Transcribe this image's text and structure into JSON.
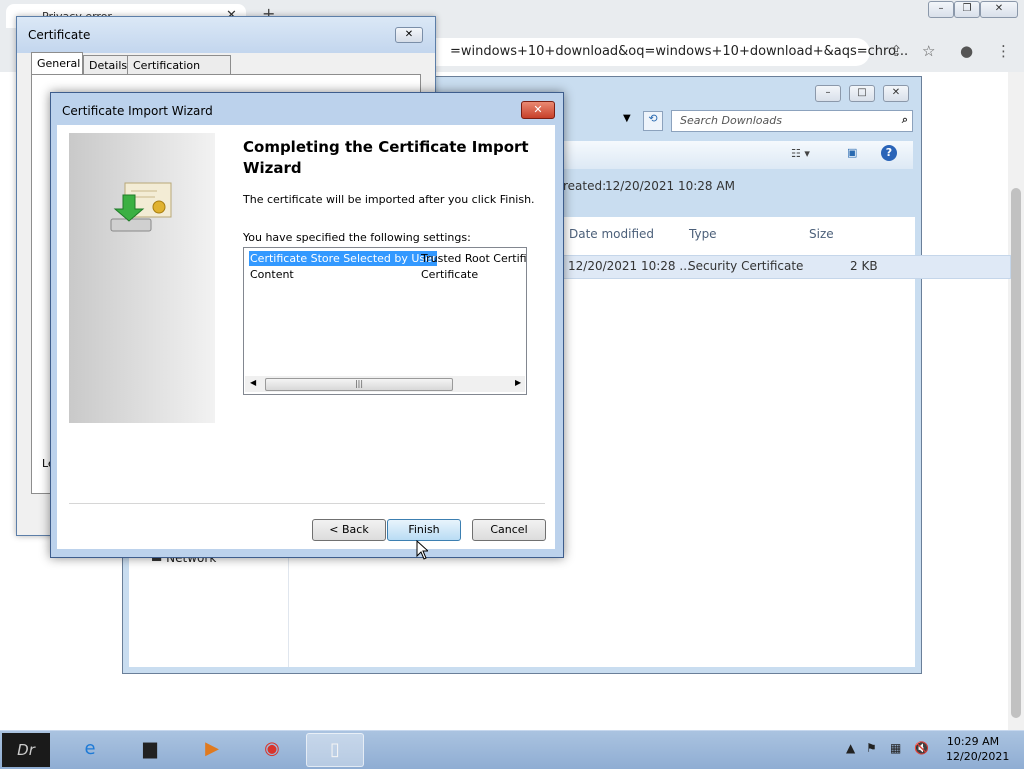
{
  "browser": {
    "tab_title": "Privacy error",
    "address_text": "=windows+10+download&oq=windows+10+download+&aqs=chro..."
  },
  "explorer": {
    "search_placeholder": "Search Downloads",
    "created_label": "reated:",
    "created_value": "12/20/2021 10:28 AM",
    "columns": {
      "date": "Date modified",
      "type": "Type",
      "size": "Size"
    },
    "file": {
      "date": "12/20/2021 10:28 ...",
      "type": "Security Certificate",
      "size": "2 KB"
    },
    "nav_network": "Network"
  },
  "cert_dialog": {
    "title": "Certificate",
    "tabs": [
      "General",
      "Details",
      "Certification Path"
    ],
    "partial_text": "Le"
  },
  "wizard": {
    "title": "Certificate Import Wizard",
    "heading": "Completing the Certificate Import Wizard",
    "text1": "The certificate will be imported after you click Finish.",
    "text2": "You have specified the following settings:",
    "settings": [
      {
        "name": "Certificate Store Selected by User",
        "value": "Trusted Root Certifica"
      },
      {
        "name": "Content",
        "value": "Certificate"
      }
    ],
    "back_label": "< Back",
    "finish_label": "Finish",
    "cancel_label": "Cancel"
  },
  "taskbar": {
    "time": "10:29 AM",
    "date": "12/20/2021"
  }
}
